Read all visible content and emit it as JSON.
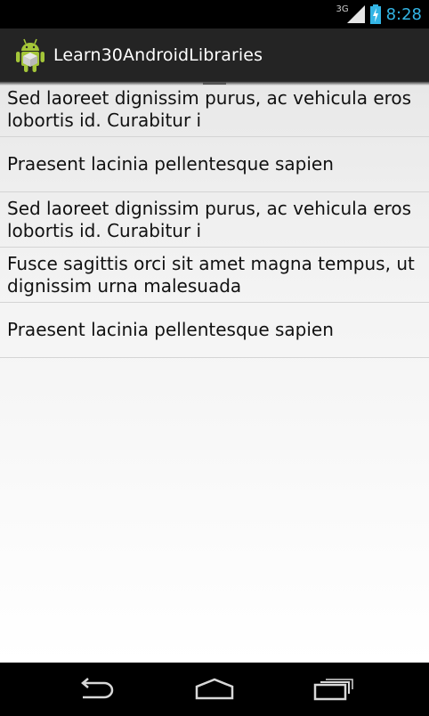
{
  "status_bar": {
    "network": "3G",
    "time": "8:28"
  },
  "action_bar": {
    "title": "Learn30AndroidLibraries",
    "app_icon": "android-icon"
  },
  "list": {
    "items": [
      {
        "text": "Sed laoreet dignissim purus, ac vehicula eros lobortis id. Curabitur i"
      },
      {
        "text": "Praesent lacinia pellentesque sapien"
      },
      {
        "text": "Sed laoreet dignissim purus, ac vehicula eros lobortis id. Curabitur i"
      },
      {
        "text": "Fusce sagittis orci sit amet magna tempus, ut dignissim urna malesuada"
      },
      {
        "text": "Praesent lacinia pellentesque sapien"
      }
    ]
  },
  "nav_bar": {
    "back": "back-icon",
    "home": "home-icon",
    "recents": "recents-icon"
  },
  "colors": {
    "accent": "#33b5e5",
    "action_bar": "#242424",
    "android_green": "#a4c639"
  }
}
